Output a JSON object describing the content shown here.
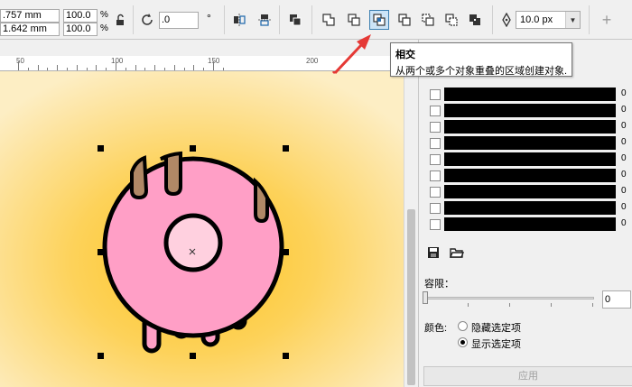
{
  "propbar": {
    "width_value": ".757 mm",
    "height_value": "1.642 mm",
    "scale_x": "100.0",
    "scale_y": "100.0",
    "percent": "%",
    "rotation_value": ".0",
    "rotation_unit": "°",
    "outline_width": "10.0 px",
    "lock_icon": "lock-icon",
    "add_icon": "+"
  },
  "ruler": {
    "labels": [
      "50",
      "100",
      "150",
      "200"
    ]
  },
  "tooltip": {
    "title": "相交",
    "description": "从两个或多个对象重叠的区域创建对象."
  },
  "panel": {
    "swatch_values": [
      "0",
      "0",
      "0",
      "0",
      "0",
      "0",
      "0",
      "0",
      "0"
    ],
    "tolerance_label": "容限：",
    "tolerance_value": "0",
    "color_label": "颜色:",
    "hide_selected": "隐藏选定项",
    "show_selected": "显示选定项",
    "apply_label": "应用",
    "selected_option": "show"
  },
  "colors": {
    "donut_pink": "#ff9fc6",
    "donut_hole": "#ffd0df",
    "drip_brown": "#b08866",
    "canvas_center": "#fcc421",
    "canvas_edge": "#fdeec4",
    "arrow_red": "#e53935",
    "active_button": "#cce4f7"
  }
}
